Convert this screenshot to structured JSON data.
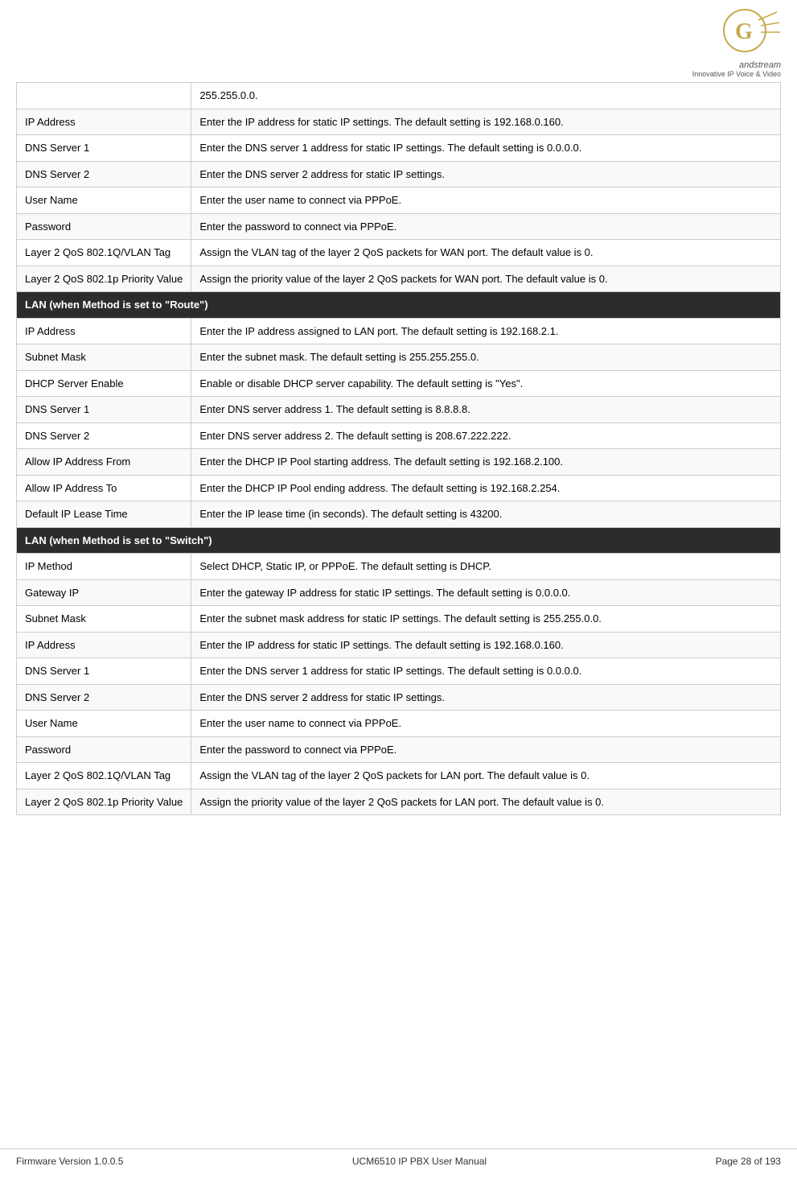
{
  "header": {
    "logo_alt": "Grandstream Logo",
    "logo_tagline": "Innovative IP Voice & Video"
  },
  "footer": {
    "firmware": "Firmware Version 1.0.0.5",
    "product": "UCM6510 IP PBX User Manual",
    "page": "Page 28 of 193"
  },
  "intro_row": {
    "label": "",
    "value": "255.255.0.0."
  },
  "rows_wan_static": [
    {
      "label": "IP Address",
      "value": "Enter the IP address for static IP settings. The default setting is 192.168.0.160."
    },
    {
      "label": "DNS Server 1",
      "value": "Enter the DNS server 1 address for static IP settings. The default setting is 0.0.0.0."
    },
    {
      "label": "DNS Server 2",
      "value": "Enter the DNS server 2 address for static IP settings."
    },
    {
      "label": "User Name",
      "value": "Enter the user name to connect via PPPoE."
    },
    {
      "label": "Password",
      "value": "Enter the password to connect via PPPoE."
    },
    {
      "label": "Layer 2 QoS 802.1Q/VLAN Tag",
      "value": "Assign the VLAN tag of the layer 2 QoS packets for WAN port. The default value is 0."
    },
    {
      "label": "Layer 2 QoS 802.1p Priority Value",
      "value": "Assign the priority value of the layer 2 QoS packets for WAN port. The default value is 0."
    }
  ],
  "section_route": {
    "label": "LAN (when Method is set to \"Route\")"
  },
  "rows_route": [
    {
      "label": "IP Address",
      "value": "Enter the IP address assigned to LAN port. The default setting is 192.168.2.1."
    },
    {
      "label": "Subnet Mask",
      "value": "Enter the subnet mask. The default setting is 255.255.255.0."
    },
    {
      "label": "DHCP Server Enable",
      "value": "Enable or disable DHCP server capability. The default setting is \"Yes\"."
    },
    {
      "label": "DNS Server 1",
      "value": "Enter DNS server address 1. The default setting is 8.8.8.8."
    },
    {
      "label": "DNS Server 2",
      "value": "Enter DNS server address 2. The default setting is 208.67.222.222."
    },
    {
      "label": "Allow IP Address From",
      "value": "Enter the DHCP IP Pool starting address. The default setting is 192.168.2.100."
    },
    {
      "label": "Allow IP Address To",
      "value": "Enter the DHCP IP Pool ending address. The default setting is 192.168.2.254."
    },
    {
      "label": "Default IP Lease Time",
      "value": "Enter the IP lease time (in seconds). The default setting is 43200."
    }
  ],
  "section_switch": {
    "label": "LAN (when Method is set to \"Switch\")"
  },
  "rows_switch": [
    {
      "label": "IP Method",
      "value": "Select DHCP, Static IP, or PPPoE. The default setting is DHCP."
    },
    {
      "label": "Gateway IP",
      "value": "Enter the gateway IP address for static IP settings. The default setting is 0.0.0.0."
    },
    {
      "label": "Subnet Mask",
      "value": "Enter the subnet mask address for static IP settings. The default setting is 255.255.0.0."
    },
    {
      "label": "IP Address",
      "value": "Enter the IP address for static IP settings. The default setting is 192.168.0.160."
    },
    {
      "label": "DNS Server 1",
      "value": "Enter the DNS server 1 address for static IP settings. The default setting is 0.0.0.0."
    },
    {
      "label": "DNS Server 2",
      "value": "Enter the DNS server 2 address for static IP settings."
    },
    {
      "label": "User Name",
      "value": "Enter the user name to connect via PPPoE."
    },
    {
      "label": "Password",
      "value": "Enter the password to connect via PPPoE."
    },
    {
      "label": "Layer 2 QoS 802.1Q/VLAN Tag",
      "value": "Assign the VLAN tag of the layer 2 QoS packets for LAN port. The default value is 0."
    },
    {
      "label": "Layer 2 QoS 802.1p Priority Value",
      "value": "Assign the priority value of the layer 2 QoS packets for LAN port. The default value is 0."
    }
  ]
}
